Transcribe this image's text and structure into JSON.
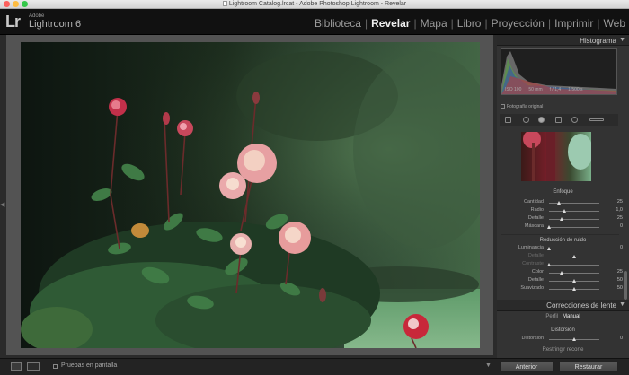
{
  "window": {
    "title": "Lightroom Catalog.lrcat - Adobe Photoshop Lightroom - Revelar"
  },
  "header": {
    "logo": "Lr",
    "brand_small": "Adobe",
    "brand_name": "Lightroom 6",
    "modules": [
      {
        "label": "Biblioteca",
        "active": false
      },
      {
        "label": "Revelar",
        "active": true
      },
      {
        "label": "Mapa",
        "active": false
      },
      {
        "label": "Libro",
        "active": false
      },
      {
        "label": "Proyección",
        "active": false
      },
      {
        "label": "Imprimir",
        "active": false
      },
      {
        "label": "Web",
        "active": false
      }
    ]
  },
  "panel": {
    "histogram_title": "Histograma",
    "histogram_info": {
      "iso": "ISO 100",
      "focal": "50 mm",
      "aperture": "f / 1,4",
      "shutter": "1/500 s"
    },
    "original_photo_label": "Fotografía original",
    "sharpening": {
      "title": "Enfoque",
      "sliders": [
        {
          "label": "Cantidad",
          "value": "25",
          "pos": 0.2
        },
        {
          "label": "Radio",
          "value": "1,0",
          "pos": 0.3
        },
        {
          "label": "Detalle",
          "value": "25",
          "pos": 0.25
        },
        {
          "label": "Máscara",
          "value": "0",
          "pos": 0.0
        }
      ]
    },
    "noise": {
      "title": "Reducción de ruido",
      "sliders": [
        {
          "label": "Luminancia",
          "value": "0",
          "pos": 0.0,
          "dim": false
        },
        {
          "label": "Detalle",
          "value": "",
          "pos": 0.5,
          "dim": true
        },
        {
          "label": "Contraste",
          "value": "",
          "pos": 0.0,
          "dim": true
        },
        {
          "label": "Color",
          "value": "25",
          "pos": 0.25,
          "dim": false
        },
        {
          "label": "Detalle",
          "value": "50",
          "pos": 0.5,
          "dim": false
        },
        {
          "label": "Suavizado",
          "value": "50",
          "pos": 0.5,
          "dim": false
        }
      ]
    },
    "lens": {
      "title": "Correcciones de lente",
      "tabs": [
        {
          "label": "Perfil",
          "active": false
        },
        {
          "label": "Manual",
          "active": true
        }
      ],
      "distortion_title": "Distorsión",
      "distortion_slider": {
        "label": "Distorsión",
        "value": "0",
        "pos": 0.5
      },
      "restrict_crop_label": "Restringir recorte"
    }
  },
  "bottom": {
    "proof_label": "Pruebas en pantalla",
    "prev_button": "Anterior",
    "reset_button": "Restaurar"
  },
  "colors": {
    "active_module": "#f0f0f0",
    "inactive_module": "#9b9b9b",
    "panel_bg": "#333333"
  }
}
